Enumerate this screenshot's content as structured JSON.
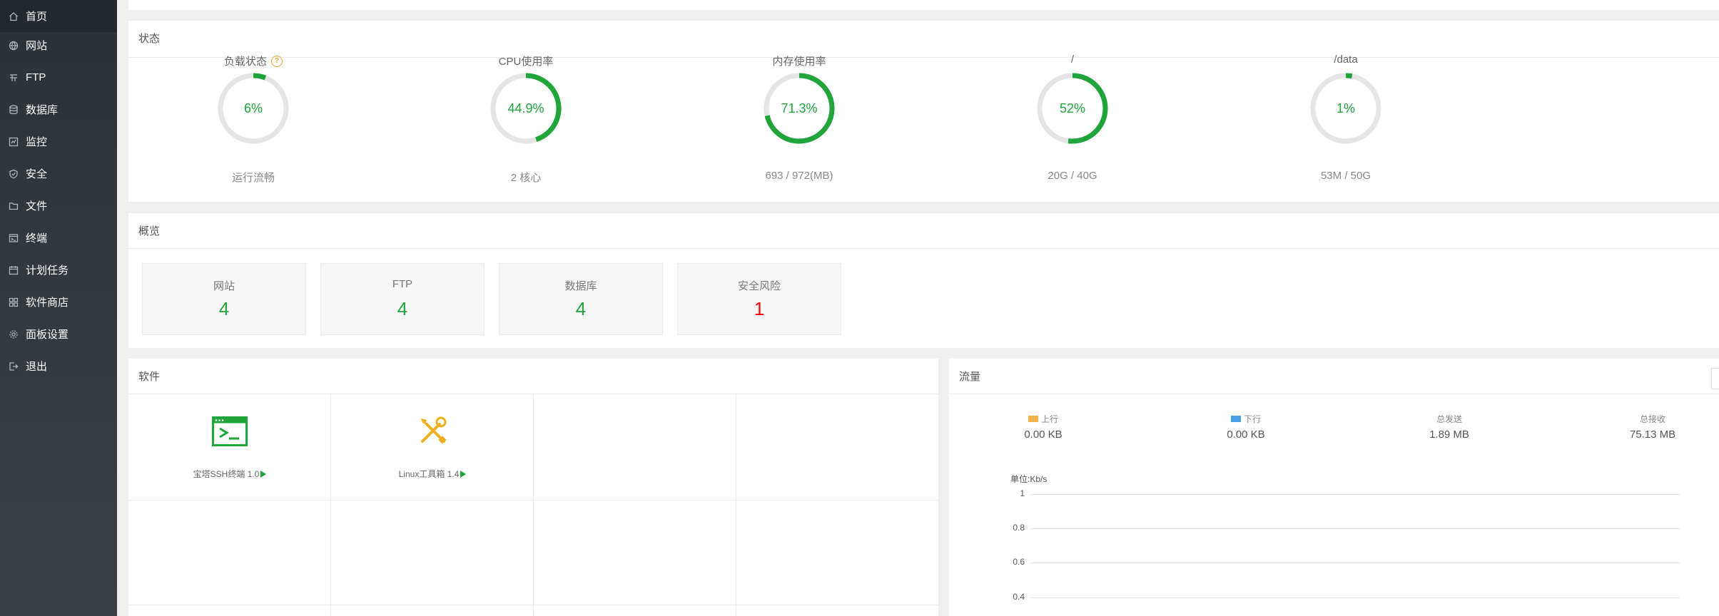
{
  "sidebar": {
    "items": [
      {
        "label": "首页",
        "icon": "home-icon",
        "active": true
      },
      {
        "label": "网站",
        "icon": "globe-icon",
        "active": false
      },
      {
        "label": "FTP",
        "icon": "ftp-icon",
        "active": false
      },
      {
        "label": "数据库",
        "icon": "database-icon",
        "active": false
      },
      {
        "label": "监控",
        "icon": "monitor-icon",
        "active": false
      },
      {
        "label": "安全",
        "icon": "shield-icon",
        "active": false
      },
      {
        "label": "文件",
        "icon": "folder-icon",
        "active": false
      },
      {
        "label": "终端",
        "icon": "terminal-icon",
        "active": false
      },
      {
        "label": "计划任务",
        "icon": "calendar-icon",
        "active": false
      },
      {
        "label": "软件商店",
        "icon": "apps-icon",
        "active": false
      },
      {
        "label": "面板设置",
        "icon": "gear-icon",
        "active": false
      },
      {
        "label": "退出",
        "icon": "logout-icon",
        "active": false
      }
    ]
  },
  "status": {
    "title": "状态",
    "gauges": [
      {
        "label": "负载状态",
        "value": "6%",
        "percent": 6,
        "sub": "运行流畅",
        "help": true
      },
      {
        "label": "CPU使用率",
        "value": "44.9%",
        "percent": 44.9,
        "sub": "2 核心"
      },
      {
        "label": "内存使用率",
        "value": "71.3%",
        "percent": 71.3,
        "sub": "693 / 972(MB)"
      },
      {
        "label": "/",
        "value": "52%",
        "percent": 52,
        "sub": "20G / 40G"
      },
      {
        "label": "/data",
        "value": "1%",
        "percent": 1,
        "sub": "53M / 50G"
      }
    ],
    "help_glyph": "?",
    "color_ok": "#20a53a",
    "color_track": "#e5e5e5"
  },
  "overview": {
    "title": "概览",
    "cards": [
      {
        "label": "网站",
        "value": "4",
        "danger": false
      },
      {
        "label": "FTP",
        "value": "4",
        "danger": false
      },
      {
        "label": "数据库",
        "value": "4",
        "danger": false
      },
      {
        "label": "安全风险",
        "value": "1",
        "danger": true
      }
    ]
  },
  "software": {
    "title": "软件",
    "items": [
      {
        "label": "宝塔SSH终端 1.0",
        "icon": "ssh-terminal-icon"
      },
      {
        "label": "Linux工具箱 1.4",
        "icon": "tools-icon"
      }
    ]
  },
  "traffic": {
    "title": "流量",
    "stats": [
      {
        "label": "上行",
        "value": "0.00 KB",
        "swatch": "#f5b04b"
      },
      {
        "label": "下行",
        "value": "0.00 KB",
        "swatch": "#4a9fe8"
      },
      {
        "label": "总发送",
        "value": "1.89 MB"
      },
      {
        "label": "总接收",
        "value": "75.13 MB"
      }
    ],
    "unit": "单位:Kb/s",
    "y_ticks": [
      "1",
      "0.8",
      "0.6",
      "0.4"
    ]
  }
}
